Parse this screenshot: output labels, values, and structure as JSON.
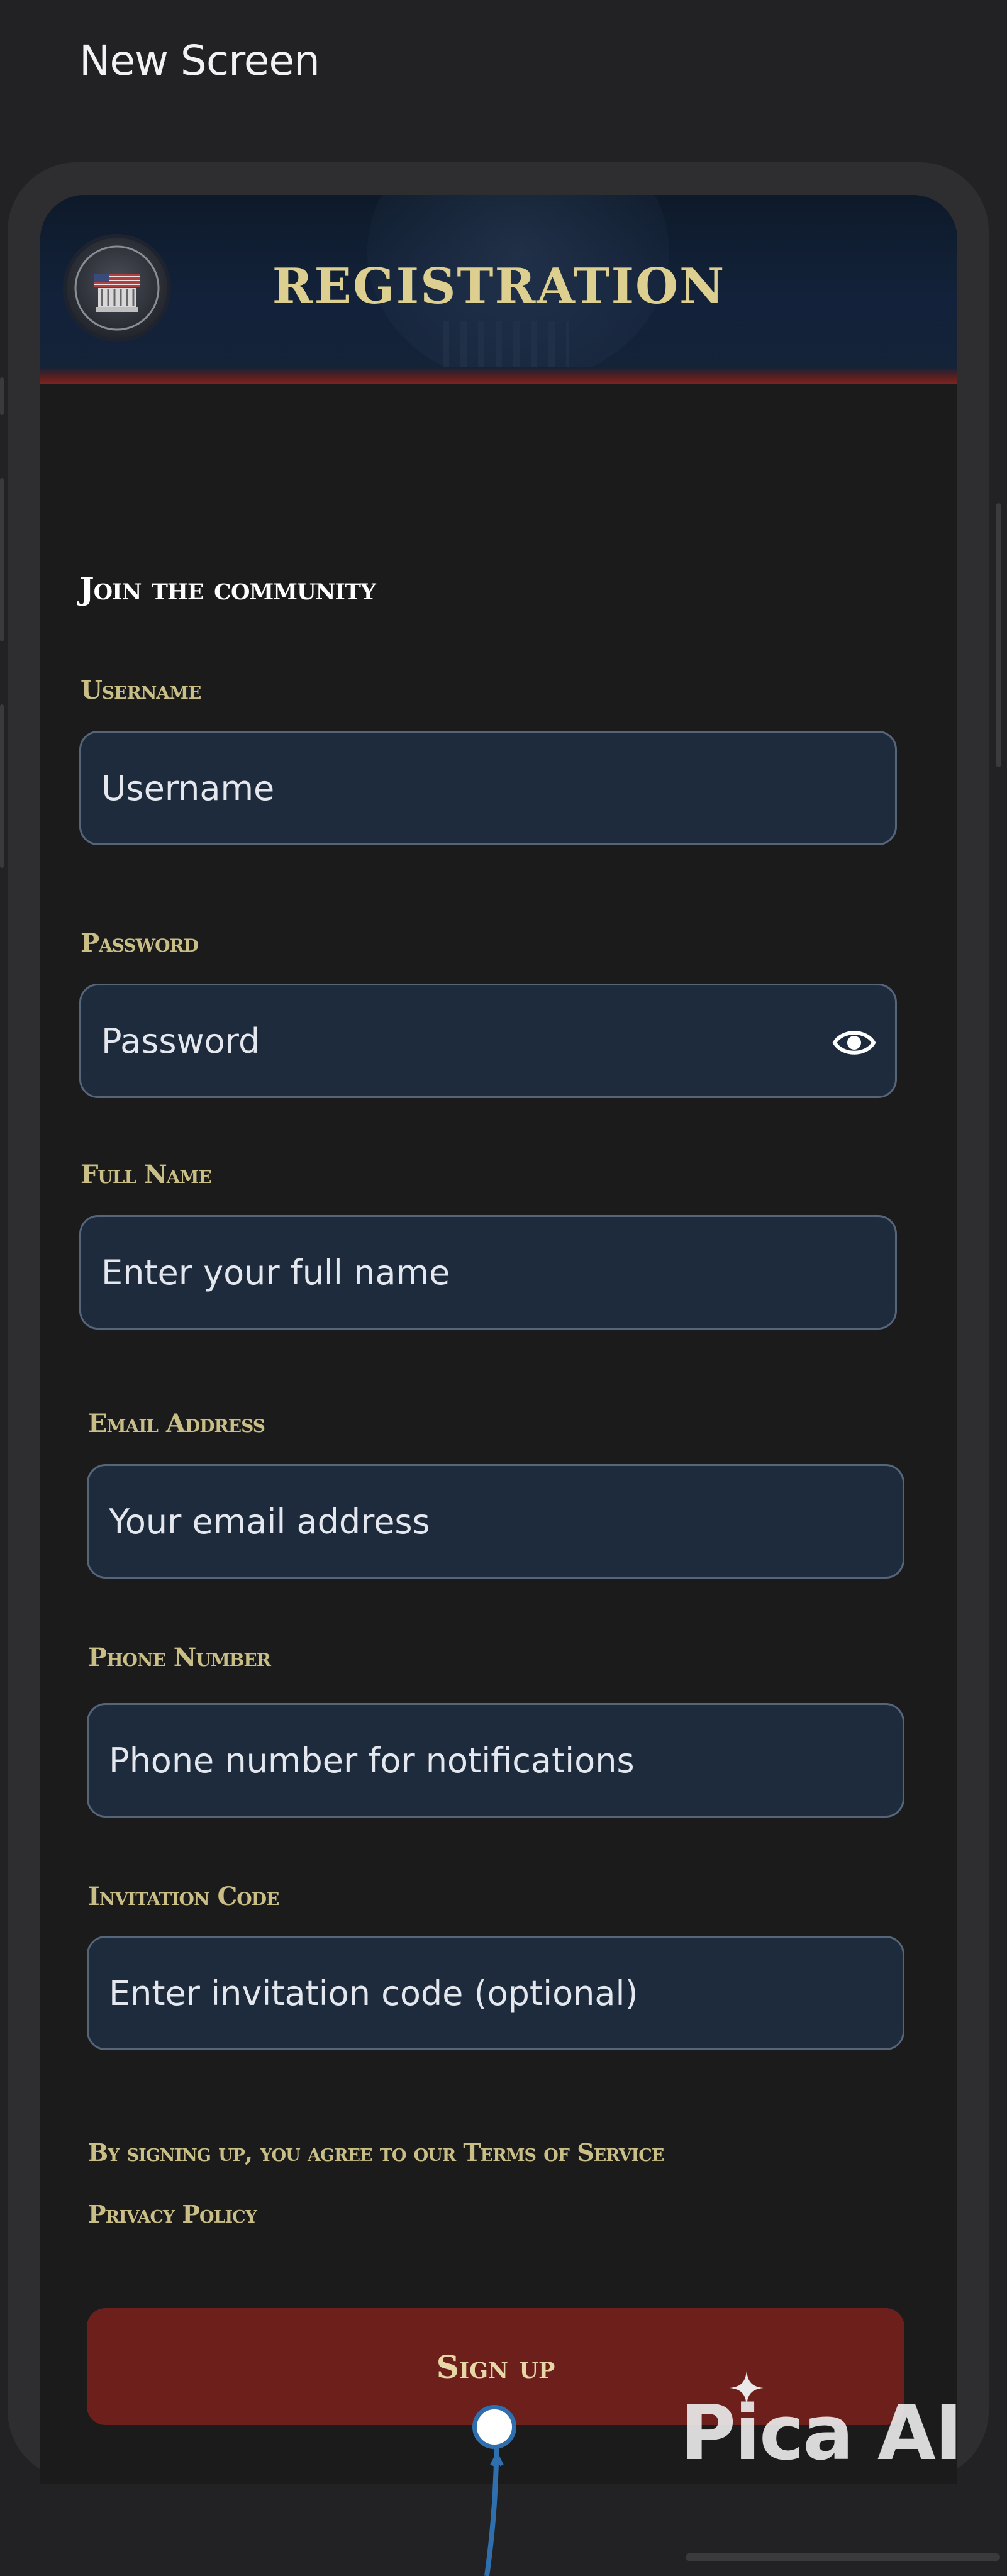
{
  "app": {
    "title": "New Screen"
  },
  "header": {
    "title": "REGISTRATION",
    "logo_icon": "capitol-seal-icon"
  },
  "form": {
    "heading": "Join the community",
    "fields": [
      {
        "label": "Username",
        "placeholder": "Username"
      },
      {
        "label": "Password",
        "placeholder": "Password",
        "icon": "eye-icon"
      },
      {
        "label": "Full Name",
        "placeholder": "Enter your full name"
      },
      {
        "label": "Email Address",
        "placeholder": "Your email address"
      },
      {
        "label": "Phone Number",
        "placeholder": "Phone number for notifications"
      },
      {
        "label": "Invitation Code",
        "placeholder": "Enter invitation code (optional)"
      }
    ],
    "terms": {
      "prefix": "By signing up, you agree to our ",
      "terms_link": "Terms of Service",
      "privacy_link": "Privacy Policy"
    },
    "submit_label": "Sign up"
  },
  "watermark": {
    "text": "Pica AI"
  },
  "colors": {
    "background": "#222224",
    "header_bg": "#13223a",
    "accent_gold": "#dccf8f",
    "label_gold": "#c9bf86",
    "field_bg": "#1d2b3c",
    "button_red": "#6d1f1c"
  }
}
